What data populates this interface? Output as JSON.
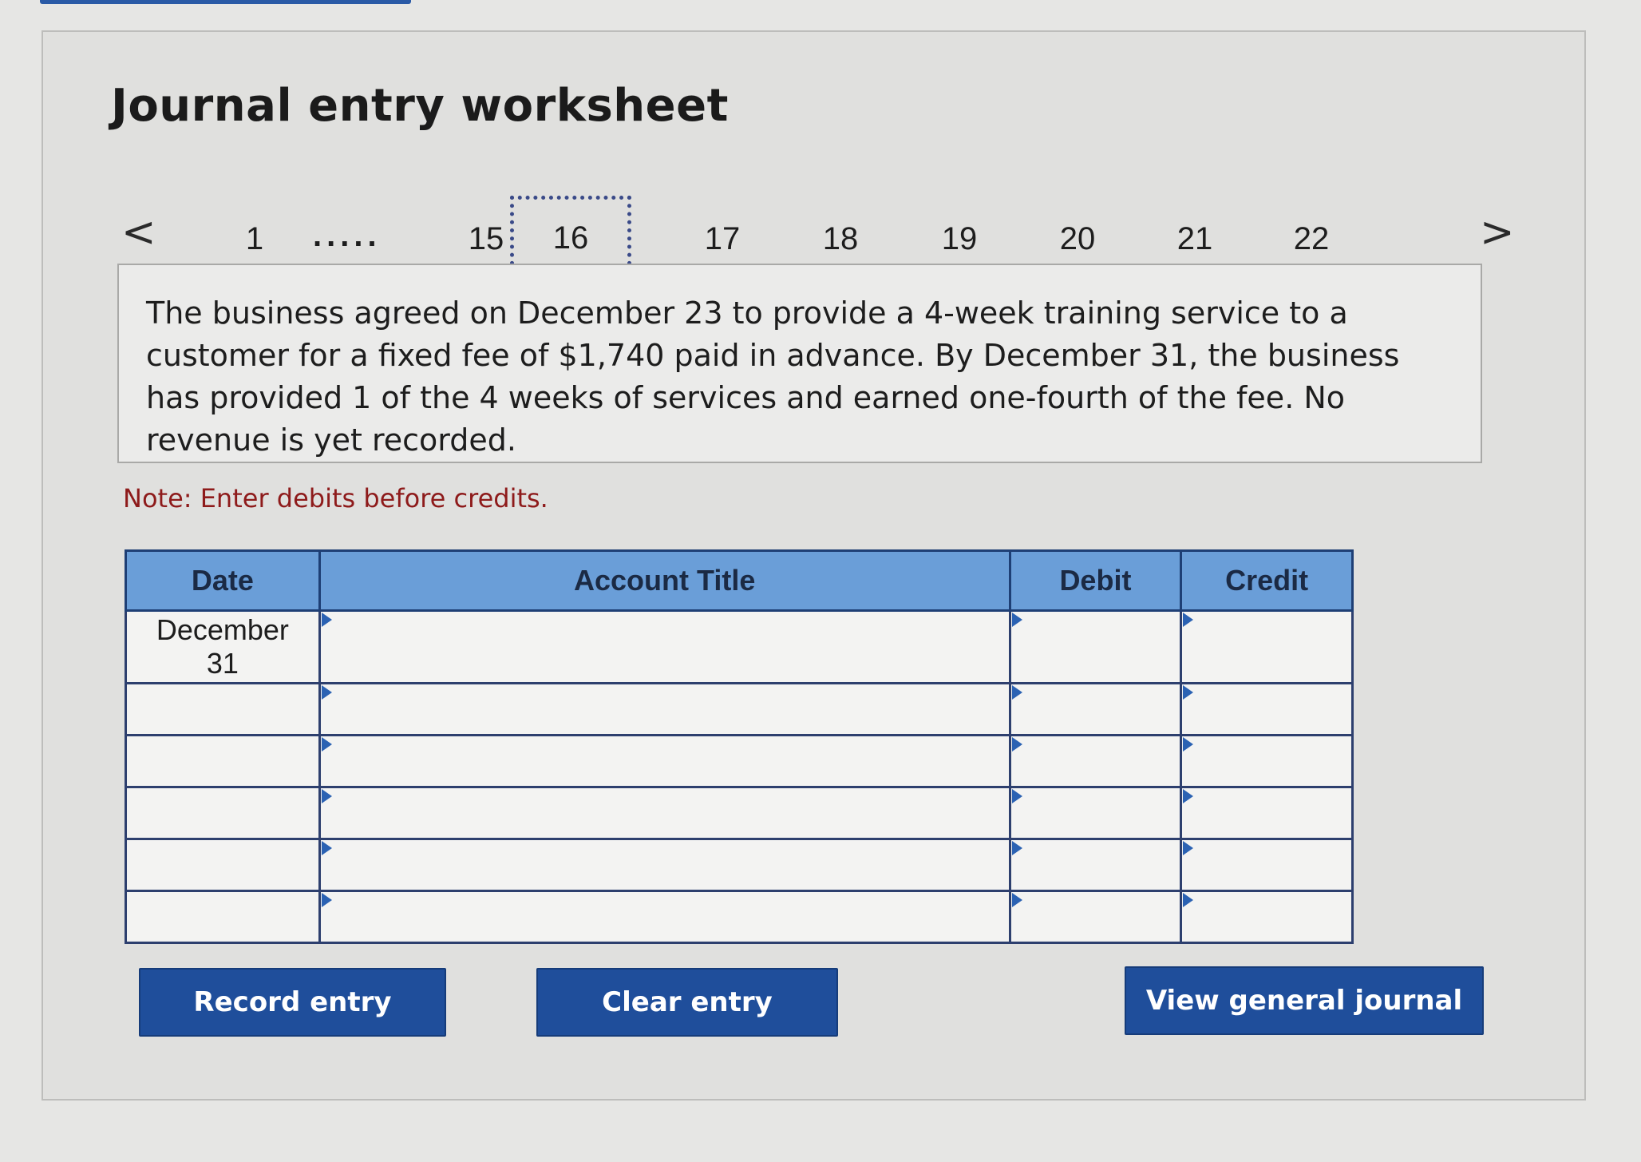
{
  "title": "Journal entry worksheet",
  "pager": {
    "prev_label": "<",
    "next_label": ">",
    "first": "1",
    "ellipsis": ".....",
    "pages": [
      "15",
      "16",
      "17",
      "18",
      "19",
      "20",
      "21",
      "22"
    ],
    "current": "16"
  },
  "problem_text": "The business agreed on December 23 to provide a 4-week training service to a customer for a fixed fee of $1,740 paid in advance. By December 31, the business has provided 1 of the 4 weeks of services and earned one-fourth of the fee. No revenue is yet recorded.",
  "note": "Note: Enter debits before credits.",
  "table": {
    "headers": {
      "date": "Date",
      "account": "Account Title",
      "debit": "Debit",
      "credit": "Credit"
    },
    "first_row_date": "December\n31",
    "first_row_date_line1": "December",
    "first_row_date_line2": "31"
  },
  "buttons": {
    "record": "Record entry",
    "clear": "Clear entry",
    "view": "View general journal"
  },
  "colors": {
    "header_blue": "#6a9ed8",
    "button_blue": "#1f4e9b",
    "note_red": "#8e1b1b"
  }
}
